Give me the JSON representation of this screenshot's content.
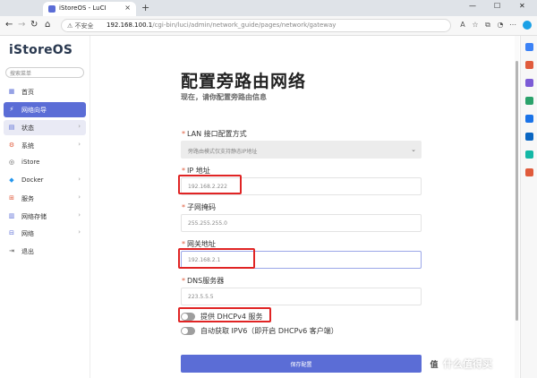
{
  "browser": {
    "tab_title": "iStoreOS - LuCI",
    "tab_close": "×",
    "new_tab": "+",
    "security_label": "不安全",
    "url_host": "192.168.100.1",
    "url_path": "/cgi-bin/luci/admin/network_guide/pages/network/gateway",
    "back_icon": "←",
    "forward_icon": "→",
    "reload_icon": "↻",
    "home_icon": "⌂",
    "min_icon": "—",
    "max_icon": "☐",
    "close_icon": "✕"
  },
  "sidebar": {
    "logo": "iStoreOS",
    "search_placeholder": "搜索菜单",
    "items": [
      {
        "label": "首页",
        "icon": "home-icon",
        "glyph": "▦",
        "color": "#5b6dd6",
        "chevron": ""
      },
      {
        "label": "网络向导",
        "icon": "wizard-icon",
        "glyph": "⚡",
        "color": "#ffffff",
        "chevron": ""
      },
      {
        "label": "状态",
        "icon": "status-icon",
        "glyph": "▤",
        "color": "#5b6dd6",
        "chevron": "›"
      },
      {
        "label": "系统",
        "icon": "system-icon",
        "glyph": "⚙",
        "color": "#e05b3c",
        "chevron": "›"
      },
      {
        "label": "iStore",
        "icon": "istore-icon",
        "glyph": "◎",
        "color": "#555555",
        "chevron": ""
      },
      {
        "label": "Docker",
        "icon": "docker-icon",
        "glyph": "◆",
        "color": "#2496ed",
        "chevron": "›"
      },
      {
        "label": "服务",
        "icon": "services-icon",
        "glyph": "⊞",
        "color": "#e05b3c",
        "chevron": "›"
      },
      {
        "label": "网络存储",
        "icon": "storage-icon",
        "glyph": "▥",
        "color": "#5b6dd6",
        "chevron": "›"
      },
      {
        "label": "网络",
        "icon": "network-icon",
        "glyph": "⊟",
        "color": "#5b6dd6",
        "chevron": "›"
      },
      {
        "label": "退出",
        "icon": "logout-icon",
        "glyph": "⇥",
        "color": "#555555",
        "chevron": ""
      }
    ]
  },
  "main": {
    "title": "配置旁路由网络",
    "subtitle": "现在，请你配置旁路由信息",
    "required_mark": "*",
    "fields": [
      {
        "label": "LAN 接口配置方式",
        "value": "旁路由模式仅支持静态IP地址"
      },
      {
        "label": "IP 地址",
        "value": "192.168.2.222"
      },
      {
        "label": "子网掩码",
        "value": "255.255.255.0"
      },
      {
        "label": "网关地址",
        "value": "192.168.2.1"
      },
      {
        "label": "DNS服务器",
        "value": "223.5.5.5"
      }
    ],
    "toggles": [
      {
        "label": "提供 DHCPv4 服务"
      },
      {
        "label": "自动获取 IPV6（即开启 DHCPv6 客户端）"
      }
    ],
    "save_label": "保存配置"
  },
  "watermark": {
    "glyph": "值",
    "text": "什么值得买"
  },
  "colors": {
    "accent": "#5b6dd6",
    "highlight": "#e02424"
  }
}
